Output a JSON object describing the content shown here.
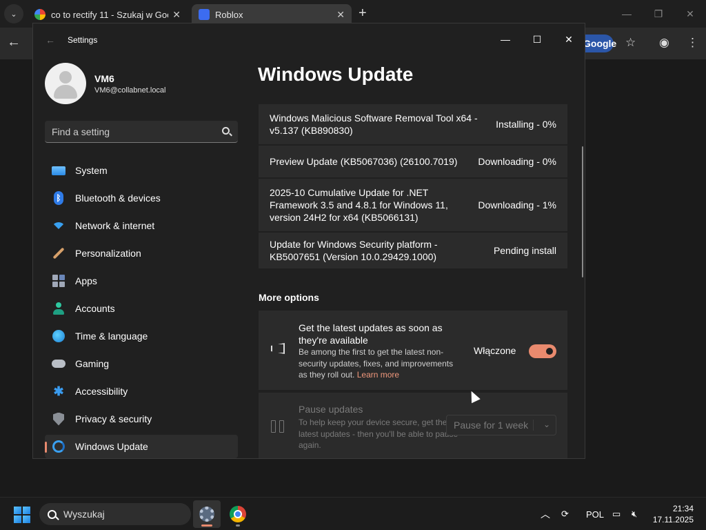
{
  "browser": {
    "tabs": [
      {
        "title": "co to rectify 11 - Szukaj w Goog",
        "close": "✕"
      },
      {
        "title": "Roblox",
        "close": "✕"
      }
    ],
    "new_tab": "+",
    "tab_list_icon": "⌄",
    "back_icon": "←",
    "google_pill": "Google",
    "toolbar_icons": [
      "star-icon",
      "profile-icon",
      "menu-icon"
    ],
    "window_controls": [
      "—",
      "❐",
      "✕"
    ]
  },
  "settings": {
    "window_title": "Settings",
    "back_icon": "←",
    "controls": {
      "minimize": "—",
      "maximize": "☐",
      "close": "✕"
    },
    "profile": {
      "name": "VM6",
      "email": "VM6@collabnet.local"
    },
    "search": {
      "placeholder": "Find a setting"
    },
    "nav": [
      {
        "label": "System",
        "icon": "system-icon"
      },
      {
        "label": "Bluetooth & devices",
        "icon": "bluetooth-icon"
      },
      {
        "label": "Network & internet",
        "icon": "wifi-icon"
      },
      {
        "label": "Personalization",
        "icon": "brush-icon"
      },
      {
        "label": "Apps",
        "icon": "apps-icon"
      },
      {
        "label": "Accounts",
        "icon": "accounts-icon"
      },
      {
        "label": "Time & language",
        "icon": "globe-icon"
      },
      {
        "label": "Gaming",
        "icon": "controller-icon"
      },
      {
        "label": "Accessibility",
        "icon": "accessibility-icon"
      },
      {
        "label": "Privacy & security",
        "icon": "shield-icon"
      },
      {
        "label": "Windows Update",
        "icon": "windows-update-icon",
        "active": true
      }
    ],
    "page_title": "Windows Update",
    "updates": [
      {
        "name": "Windows Malicious Software Removal Tool x64 - v5.137 (KB890830)",
        "status": "Installing - 0%"
      },
      {
        "name": "Preview Update (KB5067036) (26100.7019)",
        "status": "Downloading - 0%"
      },
      {
        "name": "2025-10 Cumulative Update for .NET Framework 3.5 and 4.8.1 for Windows 11, version 24H2 for x64 (KB5066131)",
        "status": "Downloading - 1%"
      },
      {
        "name": "Update for Windows Security platform - KB5007651 (Version 10.0.29429.1000)",
        "status": "Pending install"
      }
    ],
    "more_options": {
      "heading": "More options",
      "latest": {
        "title": "Get the latest updates as soon as they're available",
        "desc": "Be among the first to get the latest non-security updates, fixes, and improvements as they roll out.",
        "link": "Learn more",
        "toggle_label": "Włączone",
        "toggle_on": true
      },
      "pause": {
        "title": "Pause updates",
        "desc": "To help keep your device secure, get the latest updates - then you'll be able to pause again.",
        "select_value": "Pause for 1 week",
        "chevron": "⌄"
      }
    }
  },
  "taskbar": {
    "search_text": "Wyszukaj",
    "tray_chevron": "︿",
    "language": "POL",
    "time": "21:34",
    "date": "17.11.2025"
  },
  "colors": {
    "accent": "#e98a6e",
    "card": "#2b2b2b",
    "window": "#202020"
  }
}
